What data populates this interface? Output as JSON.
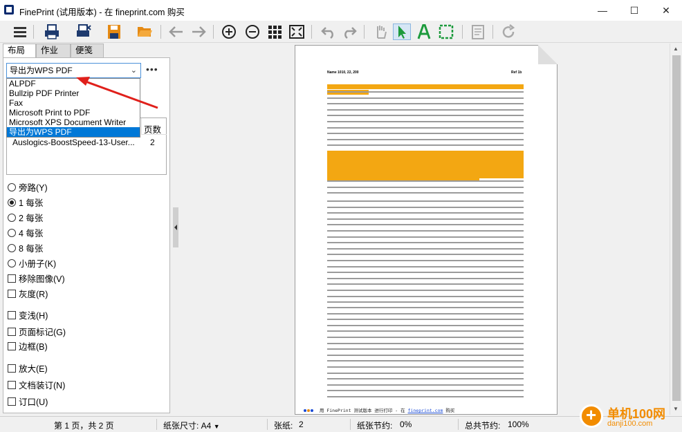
{
  "window": {
    "title": "FinePrint (试用版本) - 在 fineprint.com 购买",
    "minimize": "—",
    "maximize": "☐",
    "close": "✕"
  },
  "toolbar": {
    "buttons": [
      "menu-icon",
      "printer-icon",
      "print-save-icon",
      "save-icon",
      "open-folder-icon",
      "back-arrow-icon",
      "forward-arrow-icon",
      "zoom-in-icon",
      "zoom-out-icon",
      "grid-view-icon",
      "fit-page-icon",
      "undo-icon",
      "redo-icon",
      "hand-tool-icon",
      "select-arrow-icon",
      "text-tool-icon",
      "crop-selection-icon",
      "notes-icon",
      "refresh-icon"
    ]
  },
  "tabs": [
    "布局",
    "作业",
    "便笺"
  ],
  "printer_select": {
    "value": "导出为WPS PDF",
    "options": [
      "ALPDF",
      "Bullzip PDF Printer",
      "Fax",
      "Microsoft Print to PDF",
      "Microsoft XPS Document Writer",
      "导出为WPS PDF"
    ],
    "selected_index": 5,
    "more_label": "•••"
  },
  "job_list": {
    "column_pages": "页数",
    "rows": [
      {
        "name": "Auslogics-BoostSpeed-13-User...",
        "pages": "2"
      }
    ]
  },
  "layout_options": [
    {
      "type": "radio",
      "label": "旁路(Y)",
      "checked": false
    },
    {
      "type": "radio",
      "label": "1 每张",
      "checked": true
    },
    {
      "type": "radio",
      "label": "2 每张",
      "checked": false
    },
    {
      "type": "radio",
      "label": "4 每张",
      "checked": false
    },
    {
      "type": "radio",
      "label": "8 每张",
      "checked": false
    },
    {
      "type": "radio",
      "label": "小册子(K)",
      "checked": false
    },
    {
      "type": "check",
      "label": "移除图像(V)",
      "checked": false
    },
    {
      "type": "check",
      "label": "灰度(R)",
      "checked": false
    },
    {
      "type": "check",
      "label": "变浅(H)",
      "checked": false
    },
    {
      "type": "check",
      "label": "页面标记(G)",
      "checked": false
    },
    {
      "type": "check",
      "label": "边框(B)",
      "checked": false
    },
    {
      "type": "check",
      "label": "放大(E)",
      "checked": false
    },
    {
      "type": "check",
      "label": "文档装订(N)",
      "checked": false
    },
    {
      "type": "check",
      "label": "订口(U)",
      "checked": false
    }
  ],
  "preview": {
    "header_left": "Name 1010, 22, 200",
    "header_right": "Ref 1b",
    "footer_text": "用 FinePrint 测试版本 进行打印 - 在",
    "footer_link": "fineprint.com",
    "footer_suffix": "购买",
    "highlight_color": "#f3a712"
  },
  "status": {
    "page": "第 1 页，共 2 页",
    "paper_size_label": "纸张尺寸: A4",
    "sheets_label": "张纸:",
    "sheets_value": "2",
    "paper_saving_label": "纸张节约:",
    "paper_saving_value": "0%",
    "total_saving_label": "总共节约:",
    "total_saving_value": "100%"
  },
  "watermark": {
    "brand": "单机100网",
    "site": "danji100.com"
  },
  "colors": {
    "accent": "#0078d7",
    "annotation_arrow": "#e0201b",
    "watermark": "#f28c00"
  }
}
